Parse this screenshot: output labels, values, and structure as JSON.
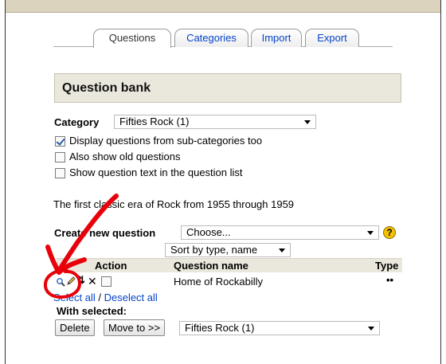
{
  "tabs": [
    {
      "label": "Questions",
      "active": true
    },
    {
      "label": "Categories",
      "active": false
    },
    {
      "label": "Import",
      "active": false
    },
    {
      "label": "Export",
      "active": false
    }
  ],
  "bank": {
    "title": "Question bank",
    "category_label": "Category",
    "category_value": "Fifties Rock (1)",
    "options": [
      {
        "label": "Display questions from sub-categories too",
        "checked": true
      },
      {
        "label": "Also show old questions",
        "checked": false
      },
      {
        "label": "Show question text in the question list",
        "checked": false
      }
    ],
    "description": "The first classic era of Rock from 1955 through 1959",
    "create_label": "Create new question",
    "create_value": "Choose...",
    "help_glyph": "?",
    "sort_value": "Sort by type, name"
  },
  "table": {
    "headers": {
      "action": "Action",
      "name": "Question name",
      "type": "Type"
    },
    "rows": [
      {
        "name": "Home of Rockabilly",
        "type": "••",
        "icons": [
          "preview-icon",
          "edit-icon",
          "move-icon",
          "delete-icon"
        ],
        "delete_glyph": "✕",
        "move_glyph": "⇅"
      }
    ]
  },
  "selection": {
    "select_all": "Select all",
    "separator": " / ",
    "deselect_all": "Deselect all",
    "with_selected": "With selected:",
    "delete_button": "Delete",
    "move_button": "Move to >>",
    "move_target": "Fifties Rock (1)"
  },
  "colors": {
    "annotation": "#e8000b",
    "link": "#0645c8",
    "header_bg": "#eae7dc"
  }
}
